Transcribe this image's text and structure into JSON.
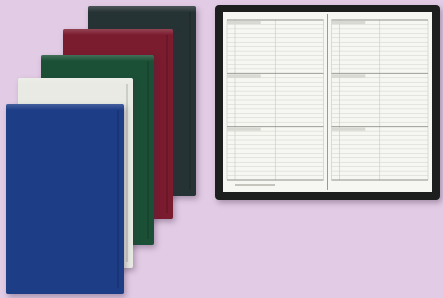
{
  "scene": {
    "background_color": "#e2cbe4",
    "notebooks": [
      {
        "id": "book-black",
        "name": "black-pocket-planner",
        "color": "#263334"
      },
      {
        "id": "book-red",
        "name": "burgundy-pocket-planner",
        "color": "#7b1b2e"
      },
      {
        "id": "book-green",
        "name": "green-pocket-planner",
        "color": "#1b5036"
      },
      {
        "id": "book-white",
        "name": "white-pocket-planner",
        "color": "#e8eae3"
      },
      {
        "id": "book-blue",
        "name": "blue-pocket-planner",
        "color": "#1d3d87"
      }
    ],
    "open_planner": {
      "cover_color": "#1d1e1e",
      "page_color": "#f6f6f2",
      "grid_color": "#c9c9c2",
      "days_per_page": 3,
      "rows_per_day": 11
    }
  }
}
